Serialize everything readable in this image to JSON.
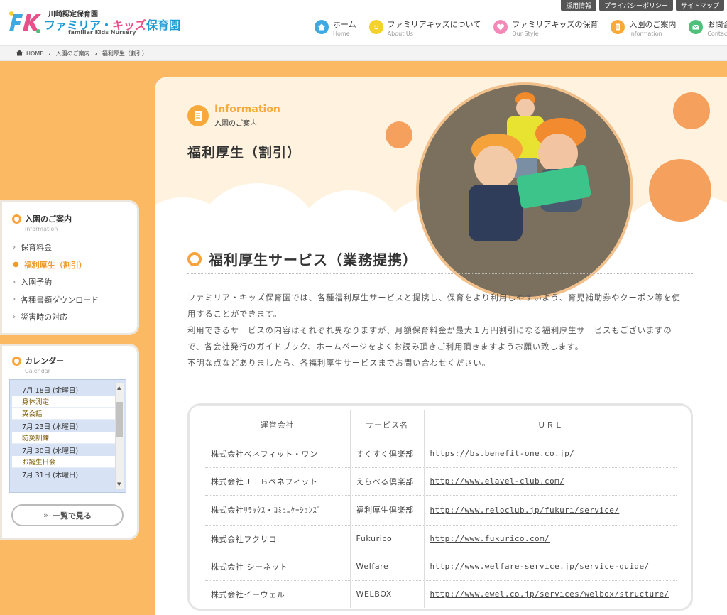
{
  "header": {
    "logo_sub": "川崎認定保育園",
    "logo_name_a": "ファミリア・",
    "logo_name_b": "キッズ",
    "logo_name_c": "保育園",
    "logo_en": "familiar Kids Nursery",
    "util_links": [
      "採用情報",
      "プライバシーポリシー",
      "サイトマップ"
    ],
    "nav": [
      {
        "jp": "ホーム",
        "en": "Home",
        "color": "#3fa9e0",
        "icon": "home-icon"
      },
      {
        "jp": "ファミリアキッズについて",
        "en": "About Us",
        "color": "#f5d12b",
        "icon": "smile-icon"
      },
      {
        "jp": "ファミリアキッズの保育",
        "en": "Our Style",
        "color": "#f28ab8",
        "icon": "heart-icon"
      },
      {
        "jp": "入園のご案内",
        "en": "Information",
        "color": "#f8a93b",
        "icon": "document-icon"
      },
      {
        "jp": "お問合せ",
        "en": "Contact",
        "color": "#4fc07a",
        "icon": "mail-icon"
      }
    ]
  },
  "breadcrumb": {
    "home": "HOME",
    "level1": "入園のご案内",
    "level2": "福利厚生（割引）"
  },
  "hero": {
    "en": "Information",
    "jp": "入園のご案内",
    "title": "福利厚生（割引）"
  },
  "section": {
    "title": "福利厚生サービス（業務提携）",
    "lead": [
      "ファミリア・キッズ保育園では、各種福利厚生サービスと提携し、保育をより利用しやすいよう、育児補助券やクーポン等を使",
      "用することができます。",
      "利用できるサービスの内容はそれぞれ異なりますが、月額保育料金が最大１万円割引になる福利厚生サービスもございますの",
      "で、各会社発行のガイドブック、ホームページをよくお読み頂きご利用頂きますようお願い致します。",
      "不明な点などありましたら、各福利厚生サービスまでお問い合わせください。"
    ]
  },
  "table": {
    "headers": [
      "運営会社",
      "サービス名",
      "ＵＲＬ"
    ],
    "rows": [
      {
        "company": "株式会社ベネフィット・ワン",
        "service": "すくすく倶楽部",
        "url": "https://bs.benefit-one.co.jp/"
      },
      {
        "company": "株式会社ＪＴＢベネフィット",
        "service": "えらべる倶楽部",
        "url": "http://www.elavel-club.com/"
      },
      {
        "company": "株式会社ﾘﾗｯｸｽ・ｺﾐｭﾆｹｰｼｮﾝｽﾞ",
        "service": "福利厚生倶楽部",
        "url": "http://www.reloclub.jp/fukuri/service/"
      },
      {
        "company": "株式会社フクリコ",
        "service": "Fukurico",
        "url": "http://www.fukurico.com/"
      },
      {
        "company": "株式会社 シーネット",
        "service": "Welfare",
        "url": "http://www.welfare-service.jp/service-guide/"
      },
      {
        "company": "株式会社イーウェル",
        "service": "WELBOX",
        "url": "http://www.ewel.co.jp/services/welbox/structure/"
      }
    ]
  },
  "sidebar": {
    "info_title": "入園のご案内",
    "info_sub": "Information",
    "items": [
      {
        "label": "保育料金",
        "active": false
      },
      {
        "label": "福利厚生（割引）",
        "active": true
      },
      {
        "label": "入園予約",
        "active": false
      },
      {
        "label": "各種書類ダウンロード",
        "active": false
      },
      {
        "label": "災害時の対応",
        "active": false
      }
    ],
    "cal_title": "カレンダー",
    "cal_sub": "Calendar",
    "calendar": [
      {
        "text": "7月 18日 (金曜日)",
        "kind": "date"
      },
      {
        "text": "身体測定",
        "kind": "ev"
      },
      {
        "text": "英会話",
        "kind": "ev"
      },
      {
        "text": "7月 23日 (水曜日)",
        "kind": "date"
      },
      {
        "text": "防災訓練",
        "kind": "ev"
      },
      {
        "text": "7月 30日 (水曜日)",
        "kind": "date"
      },
      {
        "text": "お誕生日会",
        "kind": "ev"
      },
      {
        "text": "7月 31日 (木曜日)",
        "kind": "date"
      }
    ],
    "list_button": "一覧で見る"
  }
}
